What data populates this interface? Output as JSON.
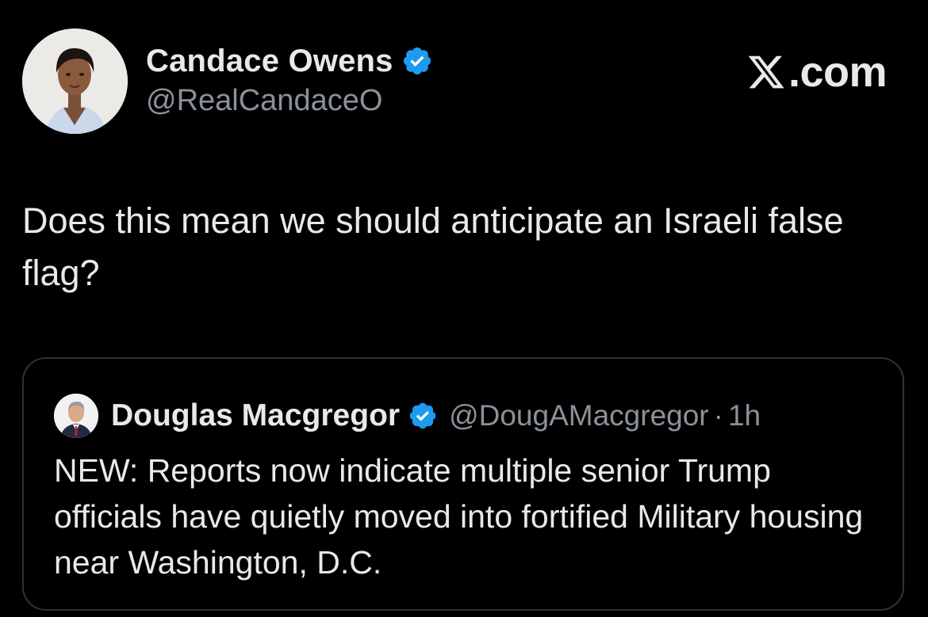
{
  "post": {
    "author": {
      "display_name": "Candace Owens",
      "handle": "@RealCandaceO",
      "verified": true,
      "avatar_icon": "profile-photo-woman"
    },
    "text": "Does this mean we should anticipate an Israeli false flag?"
  },
  "brand": {
    "logo_icon": "x-logo-icon",
    "suffix": ".com"
  },
  "quoted_post": {
    "author": {
      "display_name": "Douglas Macgregor",
      "handle": "@DougAMacgregor",
      "verified": true,
      "avatar_icon": "profile-photo-man"
    },
    "separator": "·",
    "time": "1h",
    "text": "NEW: Reports now indicate multiple senior Trump officials have quietly moved into fortified Military housing near Washington, D.C."
  },
  "colors": {
    "background": "#000000",
    "primary_text": "#e7e9ea",
    "secondary_text": "#8b9199",
    "verified_badge": "#1d9bf0",
    "card_border": "#2f3336"
  }
}
